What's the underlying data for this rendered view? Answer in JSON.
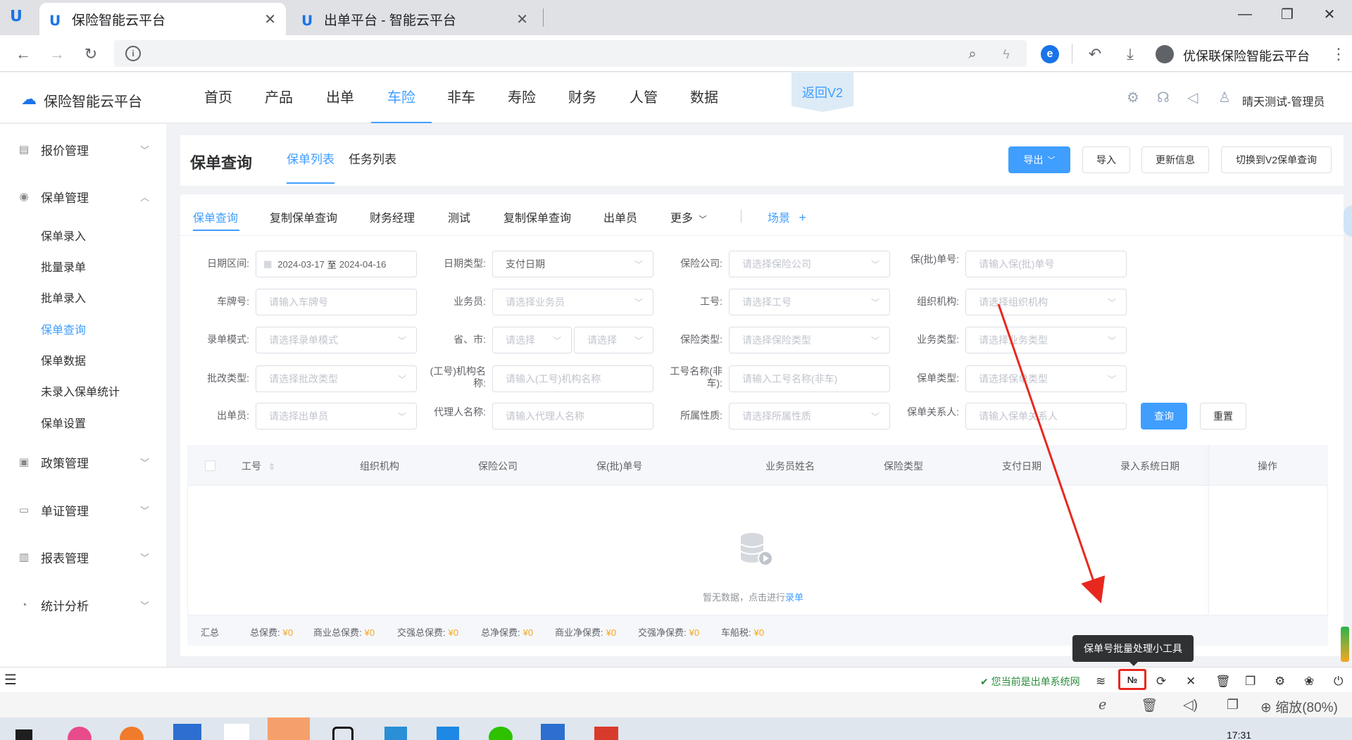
{
  "browser": {
    "tabs": [
      {
        "title": "保险智能云平台",
        "close": "✕"
      },
      {
        "title": "出单平台 - 智能云平台",
        "close": "✕"
      }
    ],
    "profile_name": "优保联保险智能云平台"
  },
  "app": {
    "logo_text": "保险智能云平台",
    "nav": [
      "首页",
      "产品",
      "出单",
      "车险",
      "非车",
      "寿险",
      "财务",
      "人管",
      "数据"
    ],
    "back_v2": "返回V2",
    "user": "晴天测试-管理员"
  },
  "sidebar": {
    "groups": [
      {
        "label": "报价管理"
      },
      {
        "label": "保单管理",
        "items": [
          "保单录入",
          "批量录单",
          "批单录入",
          "保单查询",
          "保单数据",
          "未录入保单统计",
          "保单设置"
        ]
      },
      {
        "label": "政策管理"
      },
      {
        "label": "单证管理"
      },
      {
        "label": "报表管理"
      },
      {
        "label": "统计分析"
      }
    ]
  },
  "page": {
    "title": "保单查询",
    "subtabs": [
      "保单列表",
      "任务列表"
    ],
    "buttons": {
      "export": "导出",
      "import": "导入",
      "update": "更新信息",
      "switch": "切换到V2保单查询"
    }
  },
  "query_tabs": [
    "保单查询",
    "复制保单查询",
    "财务经理",
    "测试",
    "复制保单查询",
    "出单员",
    "更多"
  ],
  "scene": "场景",
  "filters": {
    "date_range": {
      "label": "日期区间:",
      "start": "2024-03-17",
      "sep": "至",
      "end": "2024-04-16"
    },
    "date_type": {
      "label": "日期类型:",
      "value": "支付日期"
    },
    "insurer": {
      "label": "保险公司:",
      "placeholder": "请选择保险公司"
    },
    "policy_no": {
      "label": "保(批)单号:",
      "placeholder": "请输入保(批)单号"
    },
    "plate": {
      "label": "车牌号:",
      "placeholder": "请输入车牌号"
    },
    "salesman": {
      "label": "业务员:",
      "placeholder": "请选择业务员"
    },
    "job_no": {
      "label": "工号:",
      "placeholder": "请选择工号"
    },
    "org": {
      "label": "组织机构:",
      "placeholder": "请选择组织机构"
    },
    "entry_mode": {
      "label": "录单模式:",
      "placeholder": "请选择录单模式"
    },
    "province_city": {
      "label": "省、市:",
      "placeholder1": "请选择",
      "placeholder2": "请选择"
    },
    "insurance_type": {
      "label": "保险类型:",
      "placeholder": "请选择保险类型"
    },
    "business_type": {
      "label": "业务类型:",
      "placeholder": "请选择业务类型"
    },
    "endorse_type": {
      "label": "批改类型:",
      "placeholder": "请选择批改类型"
    },
    "org_name": {
      "label": "(工号)机构名称:",
      "placeholder": "请输入(工号)机构名称"
    },
    "job_name": {
      "label": "工号名称(非车):",
      "placeholder": "请输入工号名称(非车)"
    },
    "policy_type": {
      "label": "保单类型:",
      "placeholder": "请选择保单类型"
    },
    "issuer": {
      "label": "出单员:",
      "placeholder": "请选择出单员"
    },
    "agent_name": {
      "label": "代理人名称:",
      "placeholder": "请输入代理人名称"
    },
    "ownership": {
      "label": "所属性质:",
      "placeholder": "请选择所属性质"
    },
    "contact": {
      "label": "保单关系人:",
      "placeholder": "请输入保单关系人"
    },
    "query_btn": "查询",
    "reset_btn": "重置"
  },
  "table": {
    "columns": [
      "工号",
      "组织机构",
      "保险公司",
      "保(批)单号",
      "业务员姓名",
      "保险类型",
      "支付日期",
      "录入系统日期",
      "操作"
    ],
    "empty_text": "暂无数据，点击进行",
    "empty_link": "录单"
  },
  "summary": [
    {
      "label": "汇总",
      "value": ""
    },
    {
      "label": "总保费:",
      "value": "¥0"
    },
    {
      "label": "商业总保费:",
      "value": "¥0"
    },
    {
      "label": "交强总保费:",
      "value": "¥0"
    },
    {
      "label": "总净保费:",
      "value": "¥0"
    },
    {
      "label": "商业净保费:",
      "value": "¥0"
    },
    {
      "label": "交强净保费:",
      "value": "¥0"
    },
    {
      "label": "车船税:",
      "value": "¥0"
    }
  ],
  "tooltip": "保单号批量处理小工具",
  "toolbar": {
    "status": "您当前是出单系统网",
    "numero": "№"
  },
  "statusbar": {
    "zoom": "缩放(80%)"
  },
  "taskbar": {
    "time": "17:31"
  },
  "colors": {
    "primary": "#409eff",
    "orange": "#f5a623",
    "annotation_red": "#e8281f"
  }
}
